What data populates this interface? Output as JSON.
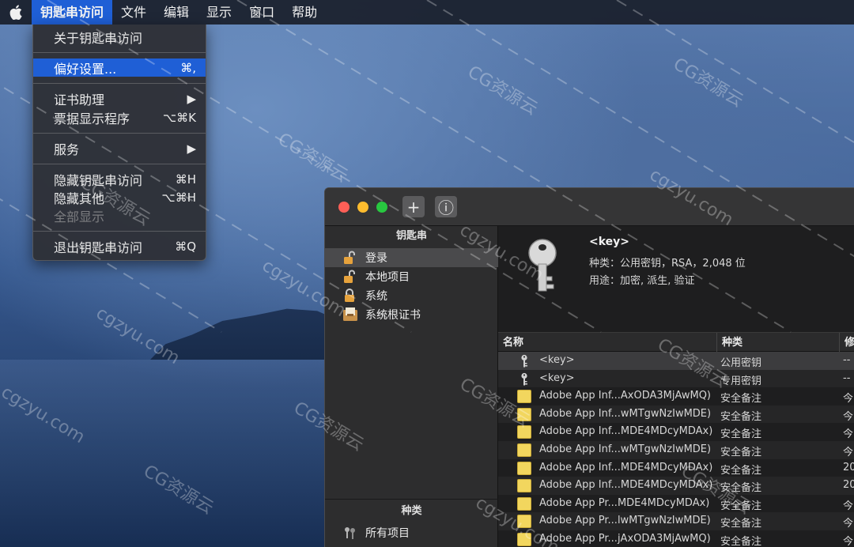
{
  "menubar": {
    "app_menu": "钥匙串访问",
    "items": [
      "文件",
      "编辑",
      "显示",
      "窗口",
      "帮助"
    ]
  },
  "app_menu_dropdown": {
    "about": "关于钥匙串访问",
    "preferences": "偏好设置...",
    "preferences_shortcut": "⌘,",
    "cert_assistant": "证书助理",
    "cert_assistant_arrow": "▶",
    "ticket_viewer": "票据显示程序",
    "ticket_viewer_shortcut": "⌥⌘K",
    "services": "服务",
    "services_arrow": "▶",
    "hide_app": "隐藏钥匙串访问",
    "hide_app_shortcut": "⌘H",
    "hide_others": "隐藏其他",
    "hide_others_shortcut": "⌥⌘H",
    "show_all": "全部显示",
    "quit": "退出钥匙串访问",
    "quit_shortcut": "⌘Q"
  },
  "toolbar": {
    "add_label": "+",
    "info_label": "ⓘ"
  },
  "sidebar": {
    "keychains_header": "钥匙串",
    "keychains": [
      "登录",
      "本地项目",
      "系统",
      "系统根证书"
    ],
    "category_header": "种类",
    "categories": [
      "所有项目"
    ]
  },
  "info_panel": {
    "title": "<key>",
    "kind_line": "种类：公用密钥，RSA，2,048 位",
    "usage_line": "用途：加密, 派生, 验证"
  },
  "table": {
    "columns": [
      "名称",
      "种类",
      "修"
    ],
    "rows": [
      {
        "name": "<key>",
        "kind": "公用密钥",
        "modified": "--",
        "icon": "key-icon"
      },
      {
        "name": "<key>",
        "kind": "专用密钥",
        "modified": "--",
        "icon": "key-icon"
      },
      {
        "name": "Adobe App Inf...AxODA3MjAwMQ)",
        "kind": "安全备注",
        "modified": "今",
        "icon": "note-icon"
      },
      {
        "name": "Adobe App Inf...wMTgwNzIwMDE)",
        "kind": "安全备注",
        "modified": "今",
        "icon": "note-icon"
      },
      {
        "name": "Adobe App Inf...MDE4MDcyMDAx)",
        "kind": "安全备注",
        "modified": "今",
        "icon": "note-icon"
      },
      {
        "name": "Adobe App Inf...wMTgwNzIwMDE)",
        "kind": "安全备注",
        "modified": "今",
        "icon": "note-icon"
      },
      {
        "name": "Adobe App Inf...MDE4MDcyMDAx)",
        "kind": "安全备注",
        "modified": "20",
        "icon": "note-icon"
      },
      {
        "name": "Adobe App Inf...MDE4MDcyMDAx)",
        "kind": "安全备注",
        "modified": "20",
        "icon": "note-icon"
      },
      {
        "name": "Adobe App Pr...MDE4MDcyMDAx)",
        "kind": "安全备注",
        "modified": "今",
        "icon": "note-icon"
      },
      {
        "name": "Adobe App Pr...lwMTgwNzIwMDE)",
        "kind": "安全备注",
        "modified": "今",
        "icon": "note-icon"
      },
      {
        "name": "Adobe App Pr...jAxODA3MjAwMQ)",
        "kind": "安全备注",
        "modified": "今",
        "icon": "note-icon"
      }
    ]
  },
  "watermark": {
    "text_a": "CG资源云",
    "text_b": "cgzyu.com"
  }
}
